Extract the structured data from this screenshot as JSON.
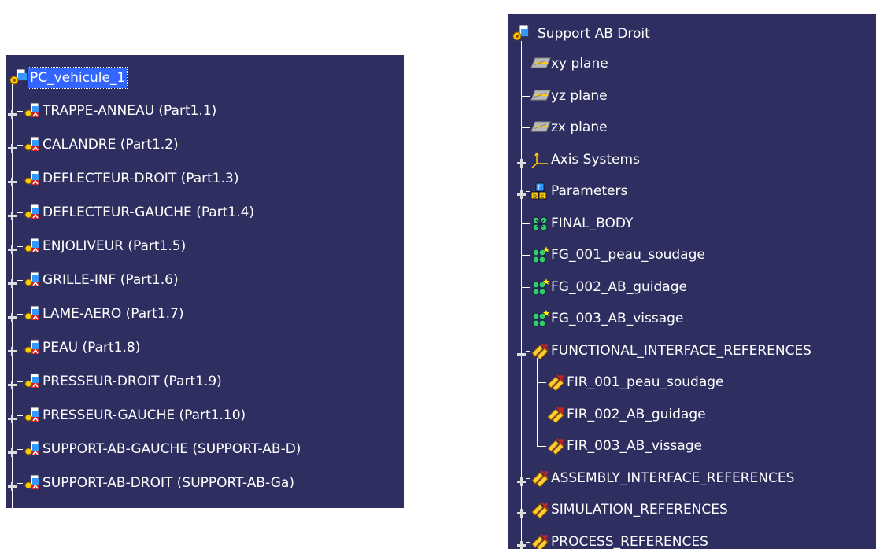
{
  "left_tree": {
    "root": "PC_vehicule_1",
    "items": [
      "TRAPPE-ANNEAU (Part1.1)",
      "CALANDRE (Part1.2)",
      "DEFLECTEUR-DROIT (Part1.3)",
      "DEFLECTEUR-GAUCHE (Part1.4)",
      "ENJOLIVEUR (Part1.5)",
      "GRILLE-INF (Part1.6)",
      "LAME-AERO (Part1.7)",
      "PEAU (Part1.8)",
      "PRESSEUR-DROIT (Part1.9)",
      "PRESSEUR-GAUCHE (Part1.10)",
      "SUPPORT-AB-GAUCHE (SUPPORT-AB-D)",
      "SUPPORT-AB-DROIT (SUPPORT-AB-Ga)"
    ]
  },
  "right_tree": {
    "root": "Support AB Droit",
    "items": [
      {
        "label": "xy plane",
        "icon": "plane-icon",
        "expander": "none",
        "depth": 1
      },
      {
        "label": "yz plane",
        "icon": "plane-icon",
        "expander": "none",
        "depth": 1
      },
      {
        "label": "zx plane",
        "icon": "plane-icon",
        "expander": "none",
        "depth": 1
      },
      {
        "label": "Axis Systems",
        "icon": "axis-system-icon",
        "expander": "plus",
        "depth": 1
      },
      {
        "label": "Parameters",
        "icon": "parameters-icon",
        "expander": "plus",
        "depth": 1
      },
      {
        "label": "FINAL_BODY",
        "icon": "body-icon",
        "expander": "none",
        "depth": 1
      },
      {
        "label": "FG_001_peau_soudage",
        "icon": "feature-group-icon",
        "expander": "none",
        "depth": 1
      },
      {
        "label": "FG_002_AB_guidage",
        "icon": "feature-group-icon",
        "expander": "none",
        "depth": 1
      },
      {
        "label": "FG_003_AB_vissage",
        "icon": "feature-group-icon",
        "expander": "none",
        "depth": 1
      },
      {
        "label": "FUNCTIONAL_INTERFACE_REFERENCES",
        "icon": "references-icon",
        "expander": "minus",
        "depth": 1
      },
      {
        "label": "FIR_001_peau_soudage",
        "icon": "references-icon",
        "expander": "none",
        "depth": 2
      },
      {
        "label": "FIR_002_AB_guidage",
        "icon": "references-icon",
        "expander": "none",
        "depth": 2
      },
      {
        "label": "FIR_003_AB_vissage",
        "icon": "references-icon",
        "expander": "none",
        "depth": 2
      },
      {
        "label": "ASSEMBLY_INTERFACE_REFERENCES",
        "icon": "references-icon",
        "expander": "plus",
        "depth": 1
      },
      {
        "label": "SIMULATION_REFERENCES",
        "icon": "references-icon",
        "expander": "plus",
        "depth": 1
      },
      {
        "label": "PROCESS_REFERENCES",
        "icon": "references-icon",
        "expander": "plus",
        "depth": 1
      }
    ]
  },
  "colors": {
    "panel_bg": "#2e2e60",
    "text": "#ffffff",
    "selection": "#3366ff"
  }
}
